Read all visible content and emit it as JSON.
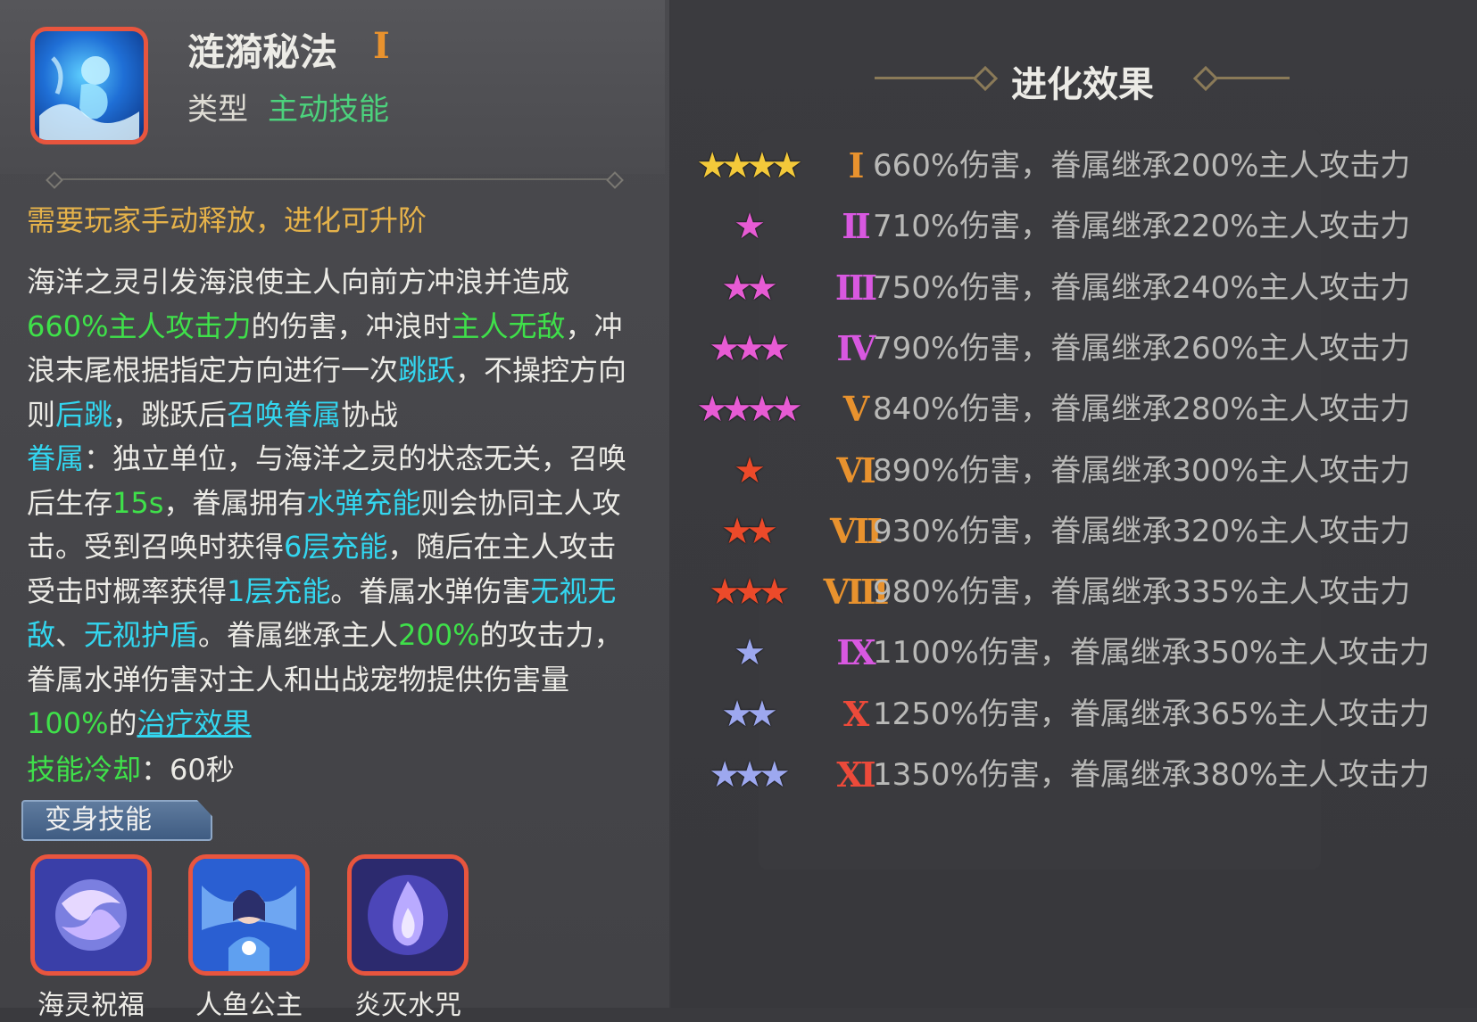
{
  "skill": {
    "name": "涟漪秘法",
    "tier": "I",
    "type_label": "类型",
    "type_value": "主动技能",
    "icon": "water-spirit-skill-icon"
  },
  "note": "需要玩家手动释放，进化可升阶",
  "description": {
    "p1": "海洋之灵引发海浪使主人向前方冲浪并造成",
    "p2_g": "660%主人攻击力",
    "p3": "的伤害，冲浪时",
    "p4_g": "主人无敌",
    "p5": "，冲浪末尾根据指定方向进行一次",
    "p6_c": "跳跃",
    "p7": "，不操控方向则",
    "p8_c": "后跳",
    "p9": "，跳跃后",
    "p10_c": "召唤眷属",
    "p11": "协战",
    "p12_c": "眷属",
    "p13": "：独立单位，与海洋之灵的状态无关，召唤后生存",
    "p14_g": "15s",
    "p15": "，眷属拥有",
    "p16_c": "水弹充能",
    "p17": "则会协同主人攻击。受到召唤时获得",
    "p18_c": "6层充能",
    "p19": "，随后在主人攻击受击时概率获得",
    "p20_c": "1层充能",
    "p21": "。眷属水弹伤害",
    "p22_c": "无视无敌",
    "p23": "、",
    "p24_c": "无视护盾",
    "p25": "。眷属继承主人",
    "p26_g": "200%",
    "p27": "的攻击力，眷属水弹伤害对主人和出战宠物提供伤害量",
    "p28_g": "100%",
    "p29": "的",
    "p30_u": "治疗效果"
  },
  "cooldown": {
    "label": "技能冷却",
    "value": "：60秒"
  },
  "transform": {
    "tag": "变身技能",
    "skills": [
      {
        "name": "海灵祝福",
        "icon": "sea-spirit-blessing-icon"
      },
      {
        "name": "人鱼公主",
        "icon": "mermaid-princess-icon"
      },
      {
        "name": "炎灭水咒",
        "icon": "flame-water-curse-icon"
      }
    ]
  },
  "evolution": {
    "title": "进化效果",
    "rows": [
      {
        "stars": 4,
        "star_color": "#f3c93a",
        "tier": "I",
        "tier_color": "#e8922e",
        "text": "660%伤害，眷属继承200%主人攻击力"
      },
      {
        "stars": 1,
        "star_color": "#e75bd4",
        "tier": "II",
        "tier_color": "#d858e0",
        "text": "710%伤害，眷属继承220%主人攻击力"
      },
      {
        "stars": 2,
        "star_color": "#e75bd4",
        "tier": "III",
        "tier_color": "#d858e0",
        "text": "750%伤害，眷属继承240%主人攻击力"
      },
      {
        "stars": 3,
        "star_color": "#e75bd4",
        "tier": "IV",
        "tier_color": "#d858e0",
        "text": "790%伤害，眷属继承260%主人攻击力"
      },
      {
        "stars": 4,
        "star_color": "#e75bd4",
        "tier": "V",
        "tier_color": "#e8922e",
        "text": "840%伤害，眷属继承280%主人攻击力"
      },
      {
        "stars": 1,
        "star_color": "#ec4a2a",
        "tier": "VI",
        "tier_color": "#e8922e",
        "text": "890%伤害，眷属继承300%主人攻击力"
      },
      {
        "stars": 2,
        "star_color": "#ec4a2a",
        "tier": "VII",
        "tier_color": "#e8922e",
        "text": "930%伤害，眷属继承320%主人攻击力"
      },
      {
        "stars": 3,
        "star_color": "#ec4a2a",
        "tier": "VIII",
        "tier_color": "#e8922e",
        "text": "980%伤害，眷属继承335%主人攻击力"
      },
      {
        "stars": 1,
        "star_color": "#9da8ef",
        "tier": "IX",
        "tier_color": "#d858e0",
        "text": "1100%伤害，眷属继承350%主人攻击力"
      },
      {
        "stars": 2,
        "star_color": "#9da8ef",
        "tier": "X",
        "tier_color": "#ec4a3a",
        "text": "1250%伤害，眷属继承365%主人攻击力"
      },
      {
        "stars": 3,
        "star_color": "#9da8ef",
        "tier": "XI",
        "tier_color": "#ec4a3a",
        "text": "1350%伤害，眷属继承380%主人攻击力"
      }
    ]
  }
}
